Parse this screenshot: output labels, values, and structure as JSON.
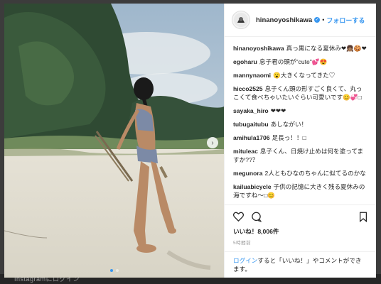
{
  "profile": {
    "username": "hinanoyoshikawa",
    "separator": "•",
    "follow_label": "フォローする"
  },
  "comments": [
    {
      "user": "hinanoyoshikawa",
      "text": "真っ黒になる夏休み❤👧🏽🍪❤"
    },
    {
      "user": "egoharu",
      "text": "息子君の頭が\"cute\"💕😍"
    },
    {
      "user": "mannynaomi",
      "text": "😮大きくなってきた♡"
    },
    {
      "user": "hicco2525",
      "text": "息子くん頭の形すごく良くて、丸っこくて食べちゃいたいぐらい可愛いです😊💞□"
    },
    {
      "user": "sayaka_hiro",
      "text": "❤❤❤"
    },
    {
      "user": "tubugaitubu",
      "text": "あしながい！"
    },
    {
      "user": "amihula1706",
      "text": "足長っ！！□"
    },
    {
      "user": "mituleac",
      "text": "息子くん、日焼け止めは何を塗ってますか??？"
    },
    {
      "user": "megunora",
      "text": "2人ともひなのちゃんに似てるのかな"
    },
    {
      "user": "kailuabicycle",
      "text": "子供の記憶に大きく残る夏休みの海ですね〜□😊"
    },
    {
      "user": "",
      "text": ""
    }
  ],
  "likes_label": "いいね！8,006件",
  "time_label": "5時間前",
  "login_prompt": {
    "link": "ログイン",
    "text": "すると「いいね！」やコメントができます。"
  },
  "backdrop_text": "Instagramにログイン",
  "icons": {
    "like": "heart-icon",
    "comment": "comment-icon",
    "save": "bookmark-icon",
    "next": "chevron-right-icon",
    "verified": "verified-badge-icon"
  },
  "colors": {
    "accent": "#3897f0",
    "text": "#262626",
    "muted": "#999999"
  }
}
